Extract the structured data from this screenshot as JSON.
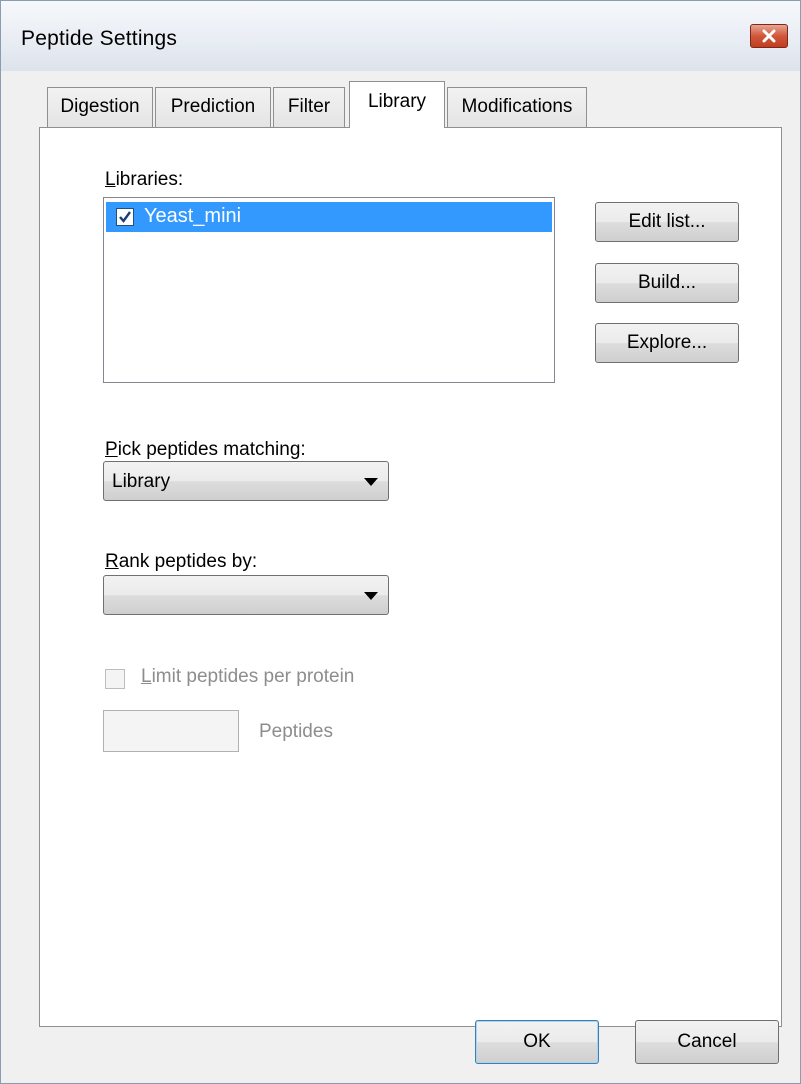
{
  "window": {
    "title": "Peptide Settings"
  },
  "tabs": [
    {
      "label": "Digestion",
      "active": false
    },
    {
      "label": "Prediction",
      "active": false
    },
    {
      "label": "Filter",
      "active": false
    },
    {
      "label": "Library",
      "active": true
    },
    {
      "label": "Modifications",
      "active": false
    }
  ],
  "libraries": {
    "label_mnemonic": "L",
    "label_rest": "ibraries:",
    "items": [
      {
        "name": "Yeast_mini",
        "checked": true,
        "selected": true
      }
    ]
  },
  "buttons": {
    "edit_list": {
      "mnemonic": "E",
      "rest": "dit list..."
    },
    "build": {
      "mnemonic": "B",
      "rest": "uild..."
    },
    "explore": {
      "mnemonic": "E",
      "rest": "xplore..."
    },
    "ok": "OK",
    "cancel": "Cancel"
  },
  "pick_peptides": {
    "label_mnemonic": "P",
    "label_rest": "ick peptides matching:",
    "value": "Library"
  },
  "rank_peptides": {
    "label_mnemonic": "R",
    "label_rest": "ank peptides by:",
    "value": ""
  },
  "limit_peptides": {
    "label_mnemonic": "L",
    "label_rest": "imit peptides per protein",
    "checked": false,
    "enabled": false,
    "count_value": "",
    "count_unit": "Peptides"
  },
  "colors": {
    "selection": "#3399ff",
    "close_button": "#c94a2c",
    "disabled_text": "#8d8d8d"
  },
  "icons": {
    "close": "close-icon",
    "checkmark": "checkmark-icon",
    "dropdown": "chevron-down-icon"
  }
}
